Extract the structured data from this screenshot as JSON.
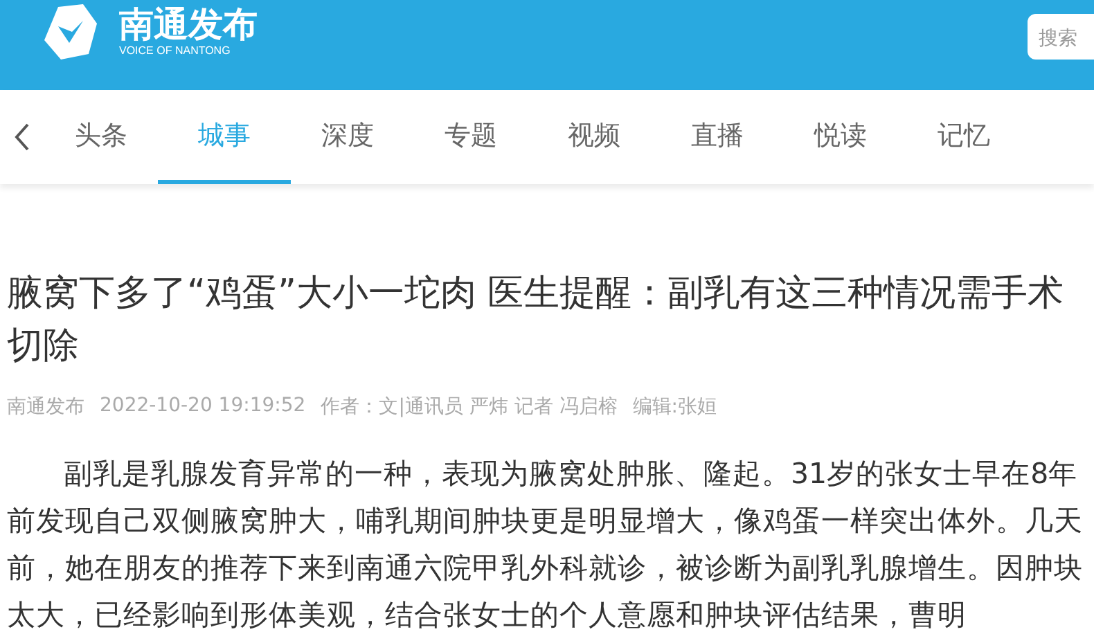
{
  "header": {
    "logo_title": "南通发布",
    "logo_subtitle": "VOICE OF NANTONG",
    "search": {
      "placeholder": "搜索"
    }
  },
  "tabs": [
    {
      "label": "头条",
      "selected": false
    },
    {
      "label": "城事",
      "selected": true
    },
    {
      "label": "深度",
      "selected": false
    },
    {
      "label": "专题",
      "selected": false
    },
    {
      "label": "视频",
      "selected": false
    },
    {
      "label": "直播",
      "selected": false
    },
    {
      "label": "悦读",
      "selected": false
    },
    {
      "label": "记忆",
      "selected": false
    }
  ],
  "article": {
    "title": "腋窝下多了“鸡蛋”大小一坨肉 医生提醒：副乳有这三种情况需手术切除",
    "meta": [
      "南通发布",
      "2022-10-20 19:19:52",
      "作者：文|通讯员 严炜 记者 冯启榕",
      "编辑:张姮"
    ],
    "body": "副乳是乳腺发育异常的一种，表现为腋窝处肿胀、隆起。31岁的张女士早在8年前发现自己双侧腋窝肿大，哺乳期间肿块更是明显增大，像鸡蛋一样突出体外。几天前，她在朋友的推荐下来到南通六院甲乳外科就诊，被诊断为副乳乳腺增生。因肿块太大，已经影响到形体美观，结合张女士的个人意愿和肿块评估结果，曹明"
  }
}
